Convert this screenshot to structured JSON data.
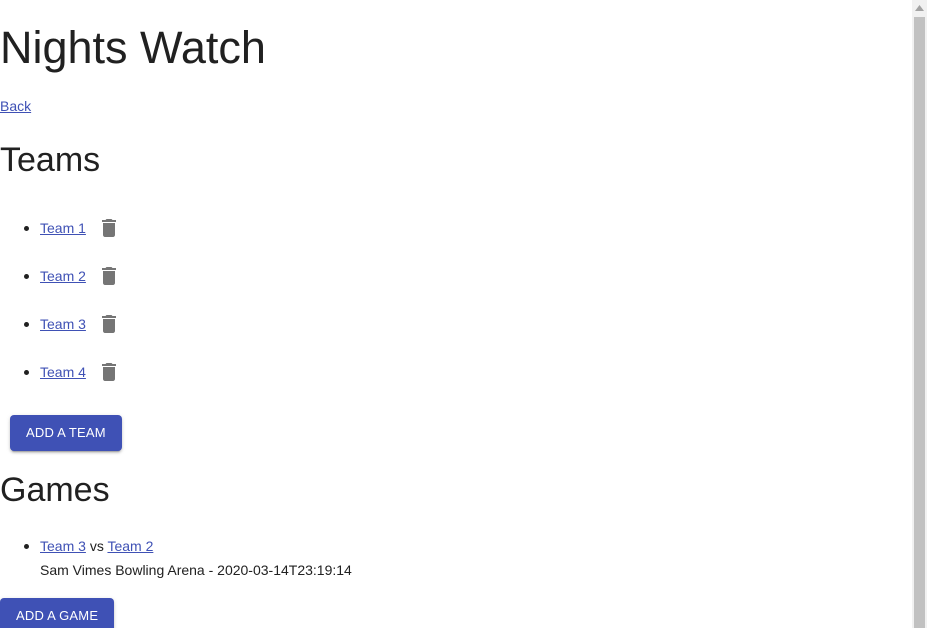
{
  "page": {
    "title": "Nights Watch",
    "back_label": "Back"
  },
  "teams": {
    "heading": "Teams",
    "items": [
      {
        "label": "Team 1"
      },
      {
        "label": "Team 2"
      },
      {
        "label": "Team 3"
      },
      {
        "label": "Team 4"
      }
    ],
    "add_button_label": "ADD A TEAM"
  },
  "games": {
    "heading": "Games",
    "items": [
      {
        "home_team": "Team 3",
        "versus": "vs",
        "away_team": "Team 2",
        "details": "Sam Vimes Bowling Arena - 2020-03-14T23:19:14"
      }
    ],
    "add_button_label": "ADD A GAME"
  },
  "icons": {
    "delete": "trash-icon",
    "scroll_up": "chevron-up-icon"
  },
  "colors": {
    "primary": "#3f51b5",
    "text": "#212121",
    "icon": "#757575"
  }
}
